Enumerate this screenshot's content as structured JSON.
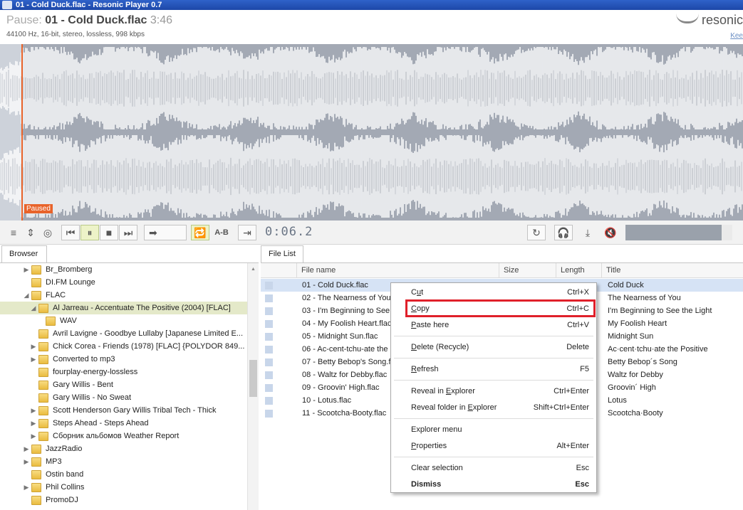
{
  "window": {
    "title": "01 - Cold Duck.flac - Resonic Player 0.7"
  },
  "header": {
    "status": "Pause:",
    "file": "01 - Cold Duck.flac",
    "duration": "3:46",
    "audio_info": "44100 Hz, 16-bit, stereo, lossless, 998 kbps",
    "logo_text": "resonic",
    "keep_link": "Kee"
  },
  "waveform": {
    "paused_label": "Paused"
  },
  "toolbar": {
    "time": "0:06.2",
    "ab_label": "A-B",
    "volume_fraction": 0.1
  },
  "tabs": {
    "browser": "Browser",
    "file_list": "File List"
  },
  "browser": {
    "items": [
      {
        "label": "Br_Bromberg",
        "expandable": true,
        "expanded": false
      },
      {
        "label": "DI.FM Lounge",
        "expandable": false
      },
      {
        "label": "FLAC",
        "expandable": true,
        "expanded": true
      },
      {
        "label": "Al Jarreau - Accentuate The Positive (2004) [FLAC]",
        "expandable": true,
        "expanded": true,
        "selected": true
      },
      {
        "label": "WAV",
        "expandable": false
      },
      {
        "label": "Avril Lavigne - Goodbye Lullaby [Japanese Limited E...",
        "expandable": false
      },
      {
        "label": "Chick Corea - Friends (1978) [FLAC] {POLYDOR 849...",
        "expandable": true,
        "expanded": false
      },
      {
        "label": "Converted to mp3",
        "expandable": true,
        "expanded": false
      },
      {
        "label": "fourplay-energy-lossless",
        "expandable": false
      },
      {
        "label": "Gary Willis - Bent",
        "expandable": false
      },
      {
        "label": "Gary Willis - No Sweat",
        "expandable": false
      },
      {
        "label": "Scott Henderson Gary Willis Tribal Tech - Thick",
        "expandable": true,
        "expanded": false
      },
      {
        "label": "Steps Ahead - Steps Ahead",
        "expandable": true,
        "expanded": false
      },
      {
        "label": "Сборник альбомов Weather Report",
        "expandable": true,
        "expanded": false
      },
      {
        "label": "JazzRadio",
        "expandable": true,
        "expanded": false
      },
      {
        "label": "MP3",
        "expandable": true,
        "expanded": false
      },
      {
        "label": "Ostin band",
        "expandable": false
      },
      {
        "label": "Phil Collins",
        "expandable": true,
        "expanded": false
      },
      {
        "label": "PromoDJ",
        "expandable": false
      }
    ]
  },
  "file_list": {
    "columns": [
      "File name",
      "Size",
      "Length",
      "Title"
    ],
    "rows": [
      {
        "name": "01 - Cold Duck.flac",
        "title": "Cold Duck",
        "selected": true
      },
      {
        "name": "02 - The Nearness of You",
        "title": "The Nearness of You"
      },
      {
        "name": "03 - I'm Beginning to See t",
        "title": "I'm Beginning to See the Light"
      },
      {
        "name": "04 - My Foolish Heart.flac",
        "title": "My Foolish Heart"
      },
      {
        "name": "05 - Midnight Sun.flac",
        "title": "Midnight Sun"
      },
      {
        "name": "06 - Ac-cent-tchu-ate the",
        "title": "Ac·cent·tchu·ate the Positive"
      },
      {
        "name": "07 - Betty Bebop's Song.f",
        "title": "Betty Bebop´s Song"
      },
      {
        "name": "08 - Waltz for Debby.flac",
        "title": "Waltz for Debby"
      },
      {
        "name": "09 - Groovin' High.flac",
        "title": "Groovin´ High"
      },
      {
        "name": "10 - Lotus.flac",
        "title": "Lotus"
      },
      {
        "name": "11 - Scootcha-Booty.flac",
        "title": "Scootcha·Booty"
      }
    ]
  },
  "context_menu": {
    "items": [
      {
        "label": "Cut",
        "shortcut": "Ctrl+X"
      },
      {
        "label": "Copy",
        "shortcut": "Ctrl+C"
      },
      {
        "label": "Paste here",
        "shortcut": "Ctrl+V"
      },
      {
        "label": "Delete (Recycle)",
        "shortcut": "Delete"
      },
      {
        "label": "Refresh",
        "shortcut": "F5"
      },
      {
        "label": "Reveal in Explorer",
        "shortcut": "Ctrl+Enter"
      },
      {
        "label": "Reveal folder in Explorer",
        "shortcut": "Shift+Ctrl+Enter"
      },
      {
        "label": "Explorer menu",
        "shortcut": ""
      },
      {
        "label": "Properties",
        "shortcut": "Alt+Enter"
      },
      {
        "label": "Clear selection",
        "shortcut": "Esc"
      },
      {
        "label": "Dismiss",
        "shortcut": "Esc"
      }
    ]
  },
  "colors": {
    "accent": "#e8632a",
    "waveform_bg": "#a3a9b4",
    "selection": "#e4e9c9",
    "highlight_box": "#e0202a"
  }
}
